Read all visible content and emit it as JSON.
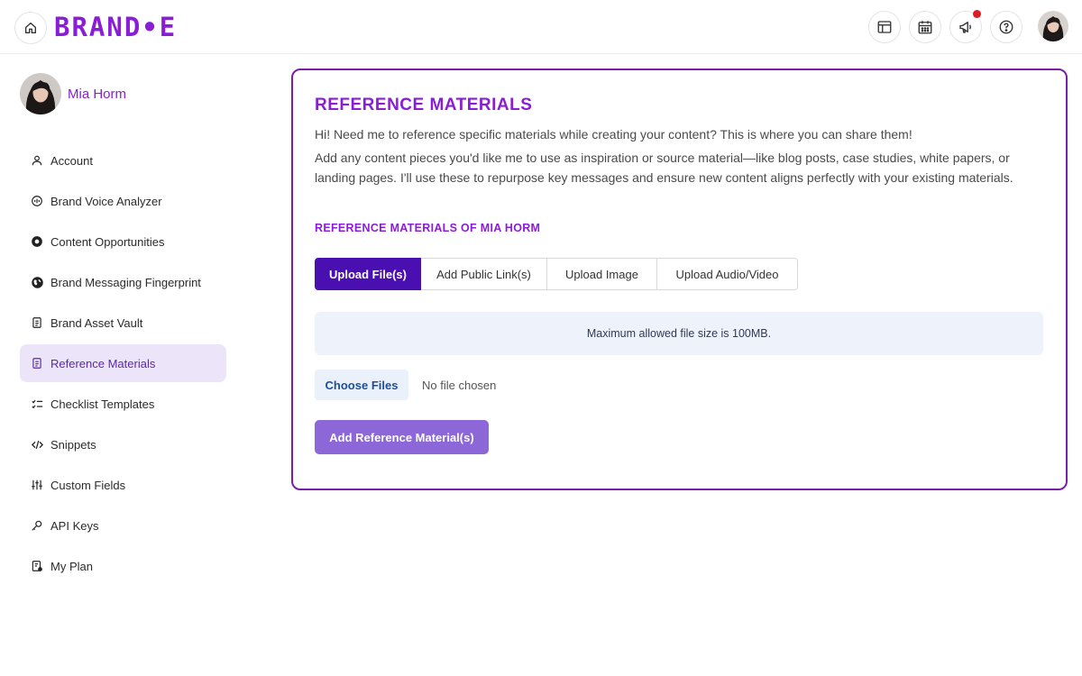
{
  "header": {
    "logo_text": "BRAND•E",
    "icons": [
      "home-icon",
      "layout-icon",
      "calendar-icon",
      "megaphone-icon",
      "help-icon"
    ],
    "notification_color": "#e01b24"
  },
  "sidebar": {
    "user_name": "Mia Horm",
    "items": [
      {
        "label": "Account",
        "icon": "user-icon"
      },
      {
        "label": "Brand Voice Analyzer",
        "icon": "voice-icon"
      },
      {
        "label": "Content Opportunities",
        "icon": "opportunities-icon"
      },
      {
        "label": "Brand Messaging Fingerprint",
        "icon": "globe-icon"
      },
      {
        "label": "Brand Asset Vault",
        "icon": "vault-icon"
      },
      {
        "label": "Reference Materials",
        "icon": "document-icon",
        "active": true
      },
      {
        "label": "Checklist Templates",
        "icon": "checklist-icon"
      },
      {
        "label": "Snippets",
        "icon": "code-icon"
      },
      {
        "label": "Custom Fields",
        "icon": "sliders-icon"
      },
      {
        "label": "API Keys",
        "icon": "key-icon"
      },
      {
        "label": "My Plan",
        "icon": "plan-icon"
      }
    ]
  },
  "main": {
    "title": "REFERENCE MATERIALS",
    "intro": "Hi! Need me to reference specific materials while creating your content? This is where you can share them!",
    "description": "Add any content pieces you'd like me to use as inspiration or source material—like blog posts, case studies, white papers, or landing pages. I'll use these to repurpose key messages and ensure new content aligns perfectly with your existing materials.",
    "subtitle": "REFERENCE MATERIALS OF MIA HORM",
    "tabs": [
      {
        "label": "Upload File(s)",
        "active": true
      },
      {
        "label": "Add Public Link(s)",
        "active": false
      },
      {
        "label": "Upload Image",
        "active": false
      },
      {
        "label": "Upload Audio/Video",
        "active": false
      }
    ],
    "info": "Maximum allowed file size is 100MB.",
    "choose_label": "Choose Files",
    "no_file_label": "No file chosen",
    "submit_label": "Add Reference Material(s)"
  },
  "colors": {
    "brand": "#8a1dd6",
    "active_tab": "#4a0fb0",
    "submit": "#8c67d8",
    "card_border": "#7a1fa8"
  }
}
